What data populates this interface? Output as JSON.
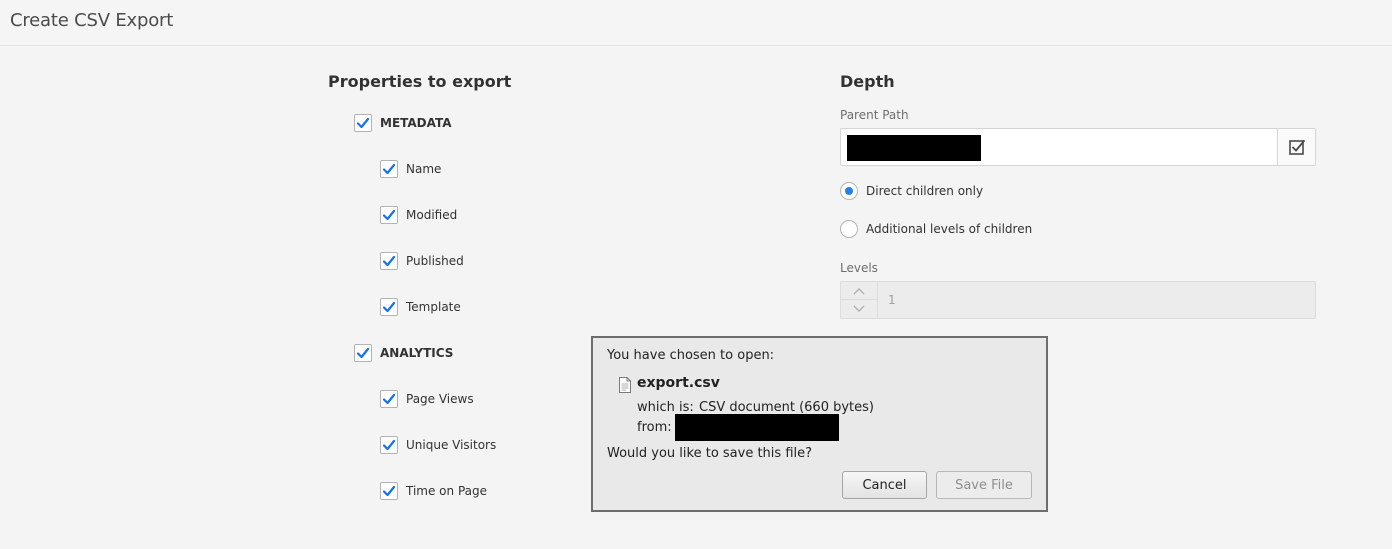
{
  "header": {
    "title": "Create CSV Export"
  },
  "properties": {
    "heading": "Properties to export",
    "groups": [
      {
        "label": "METADATA",
        "checked": true,
        "items": [
          {
            "label": "Name",
            "checked": true
          },
          {
            "label": "Modified",
            "checked": true
          },
          {
            "label": "Published",
            "checked": true
          },
          {
            "label": "Template",
            "checked": true
          }
        ]
      },
      {
        "label": "ANALYTICS",
        "checked": true,
        "items": [
          {
            "label": "Page Views",
            "checked": true
          },
          {
            "label": "Unique Visitors",
            "checked": true
          },
          {
            "label": "Time on Page",
            "checked": true
          }
        ]
      }
    ]
  },
  "depth": {
    "heading": "Depth",
    "parent_path_label": "Parent Path",
    "options": [
      {
        "label": "Direct children only",
        "selected": true
      },
      {
        "label": "Additional levels of children",
        "selected": false
      }
    ],
    "levels_label": "Levels",
    "levels_value": "1"
  },
  "dialog": {
    "intro": "You have chosen to open:",
    "filename": "export.csv",
    "which_is_label": "which is:",
    "file_type": "CSV document (660 bytes)",
    "from_label": "from:",
    "question": "Would you like to save this file?",
    "cancel_label": "Cancel",
    "save_label": "Save File"
  },
  "colors": {
    "accent": "#2680eb",
    "checkmark": "#1473e6"
  }
}
